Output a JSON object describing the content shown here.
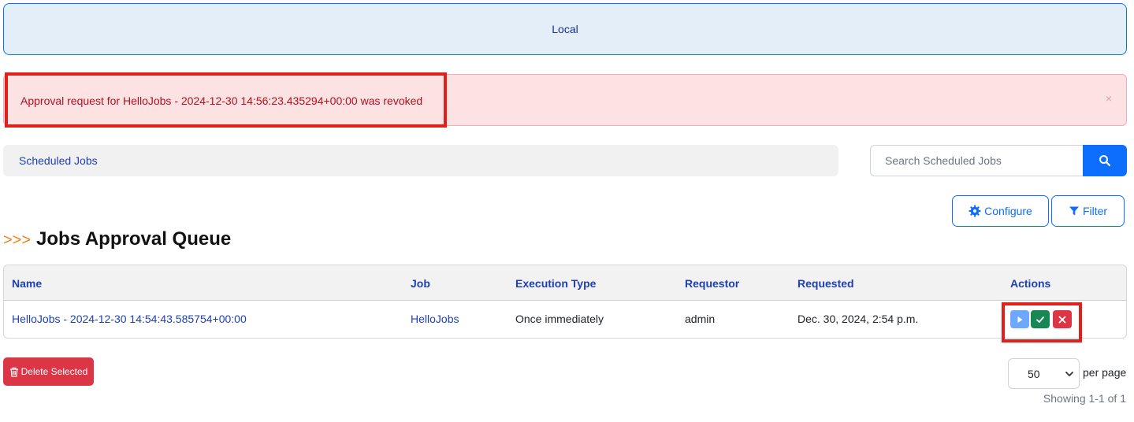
{
  "environment": {
    "label": "Local"
  },
  "alert": {
    "message": "Approval request for HelloJobs - 2024-12-30 14:56:23.435294+00:00 was revoked",
    "close_glyph": "×"
  },
  "breadcrumb": {
    "label": "Scheduled Jobs"
  },
  "search": {
    "placeholder": "Search Scheduled Jobs",
    "icon": "search-icon"
  },
  "toolbar": {
    "configure_label": "Configure",
    "configure_icon": "gear-icon",
    "filter_label": "Filter",
    "filter_icon": "filter-icon"
  },
  "page": {
    "arrows": ">>>",
    "title": "Jobs Approval Queue"
  },
  "table": {
    "columns": [
      "Name",
      "Job",
      "Execution Type",
      "Requestor",
      "Requested",
      "Actions"
    ],
    "rows": [
      {
        "name": "HelloJobs - 2024-12-30 14:54:43.585754+00:00",
        "job": "HelloJobs",
        "execution_type": "Once immediately",
        "requestor": "admin",
        "requested": "Dec. 30, 2024, 2:54 p.m.",
        "actions": [
          "run-icon",
          "approve-icon",
          "revoke-icon"
        ]
      }
    ]
  },
  "footer": {
    "delete_label": "Delete Selected",
    "per_page_value": "50",
    "per_page_label": "per page",
    "showing": "Showing 1-1 of 1"
  },
  "colors": {
    "primary": "#0d6efd",
    "danger": "#dc3545",
    "success": "#198754",
    "alert_bg": "#fde2e3",
    "highlight": "#e0201b",
    "title_arrows": "#f07e1b"
  }
}
